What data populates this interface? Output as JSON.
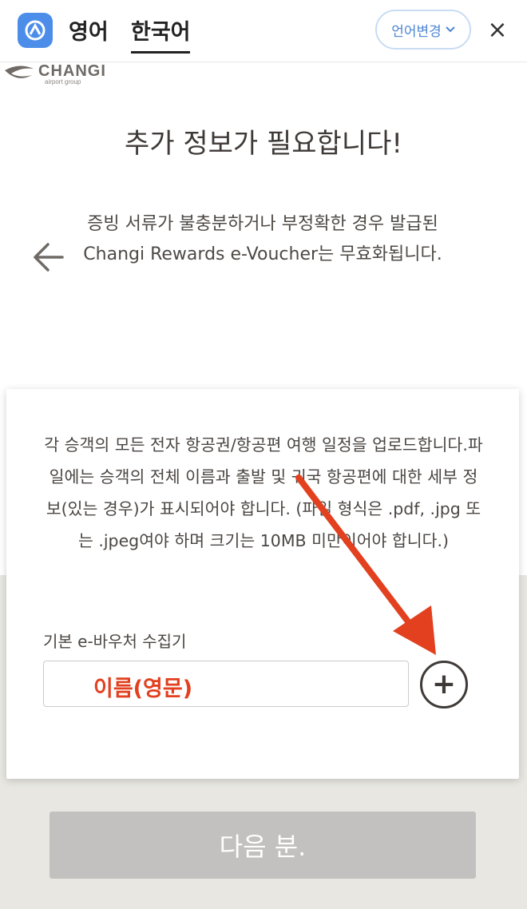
{
  "topbar": {
    "lang_en": "영어",
    "lang_ko": "한국어",
    "lang_change": "언어변경",
    "close_glyph": "×"
  },
  "brand": {
    "name": "CHANGI",
    "sub": "airport group"
  },
  "page": {
    "title": "추가 정보가 필요합니다!",
    "warning": "증빙 서류가 불충분하거나 부정확한 경우 발급된 Changi Rewards e-Voucher는 무효화됩니다."
  },
  "card": {
    "instructions": "각 승객의 모든 전자 항공권/항공편 여행 일정을 업로드합니다.파일에는 승객의 전체 이름과 출발 및 귀국 항공편에 대한 세부 정보(있는 경우)가 표시되어야 합니다. (파일 형식은 .pdf, .jpg 또는 .jpeg여야 하며 크기는 10MB 미만이어야 합니다.)",
    "field_label": "기본 e-바우처 수집기",
    "name_placeholder": "이름(영문)",
    "add_glyph": "+"
  },
  "next_button": "다음 분.",
  "colors": {
    "accent_blue": "#4c8dea",
    "annotation_red": "#e2401f",
    "disabled_button": "#c3c1bf"
  },
  "icons": [
    "app-logo-icon",
    "chevron-down-icon",
    "close-icon",
    "changi-logo-icon",
    "back-arrow-icon",
    "plus-circle-icon",
    "annotation-arrow"
  ]
}
